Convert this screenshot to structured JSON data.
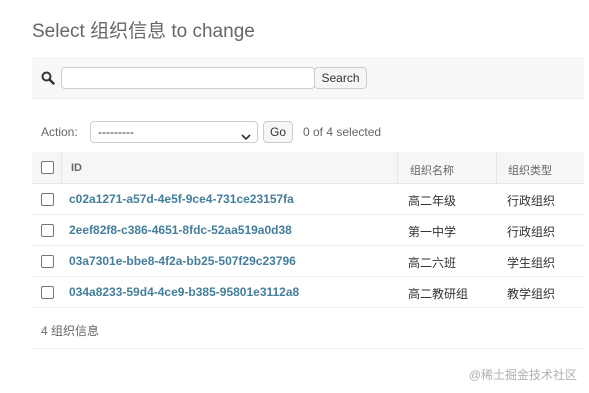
{
  "header": {
    "title": "Select 组织信息 to change"
  },
  "search": {
    "icon": "search-icon",
    "value": "",
    "button_label": "Search"
  },
  "actions": {
    "label": "Action:",
    "selected_option": "---------",
    "go_label": "Go",
    "selection_count": "0 of 4 selected"
  },
  "table": {
    "columns": {
      "id": "ID",
      "name": "组织名称",
      "type": "组织类型"
    },
    "rows": [
      {
        "id": "c02a1271-a57d-4e5f-9ce4-731ce23157fa",
        "name": "高二年级",
        "type": "行政组织"
      },
      {
        "id": "2eef82f8-c386-4651-8fdc-52aa519a0d38",
        "name": "第一中学",
        "type": "行政组织"
      },
      {
        "id": "03a7301e-bbe8-4f2a-bb25-507f29c23796",
        "name": "高二六班",
        "type": "学生组织"
      },
      {
        "id": "034a8233-59d4-4ce9-b385-95801e3112a8",
        "name": "高二教研组",
        "type": "教学组织"
      }
    ]
  },
  "paginator": {
    "text": "4 组织信息"
  },
  "watermark": "@稀土掘金技术社区",
  "colors": {
    "link": "#447e9b",
    "header_bg": "#f6f6f6",
    "muted_text": "#666666"
  }
}
